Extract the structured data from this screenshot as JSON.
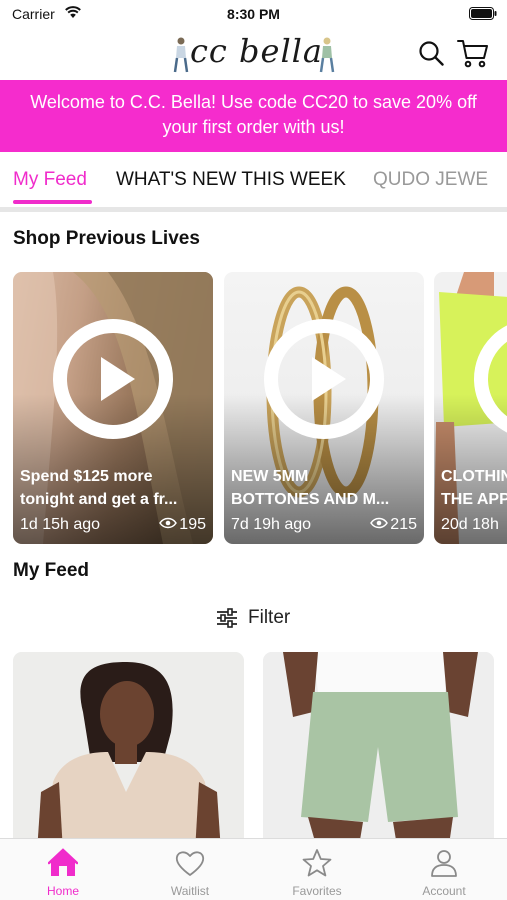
{
  "status_bar": {
    "carrier": "Carrier",
    "time": "8:30 PM"
  },
  "header": {
    "logo_text": "cc bella"
  },
  "colors": {
    "accent": "#f02ccb",
    "banner": "#f52ccd"
  },
  "promo": {
    "line1": "Welcome to C.C. Bella! Use code CC20 to save 20% off",
    "line2": "your first order with us!"
  },
  "tabs": [
    {
      "label": "My Feed",
      "active": true
    },
    {
      "label": "WHAT'S NEW THIS WEEK"
    },
    {
      "label": "QUDO JEWE"
    }
  ],
  "previous_lives": {
    "title": "Shop Previous Lives",
    "items": [
      {
        "title_line1": "Spend $125 more",
        "title_line2": "tonight and get a fr...",
        "time": "1d 15h ago",
        "views": "195"
      },
      {
        "title_line1": "NEW 5MM",
        "title_line2": "BOTTONES AND M...",
        "time": "7d 19h ago",
        "views": "215"
      },
      {
        "title_line1": "CLOTHIN",
        "title_line2": "THE APP",
        "time": "20d 18h",
        "views": ""
      }
    ]
  },
  "feed": {
    "title": "My Feed",
    "filter_label": "Filter"
  },
  "bottom_nav": [
    {
      "label": "Home",
      "icon": "home-icon",
      "active": true
    },
    {
      "label": "Waitlist",
      "icon": "heart-icon"
    },
    {
      "label": "Favorites",
      "icon": "star-icon"
    },
    {
      "label": "Account",
      "icon": "person-icon"
    }
  ]
}
